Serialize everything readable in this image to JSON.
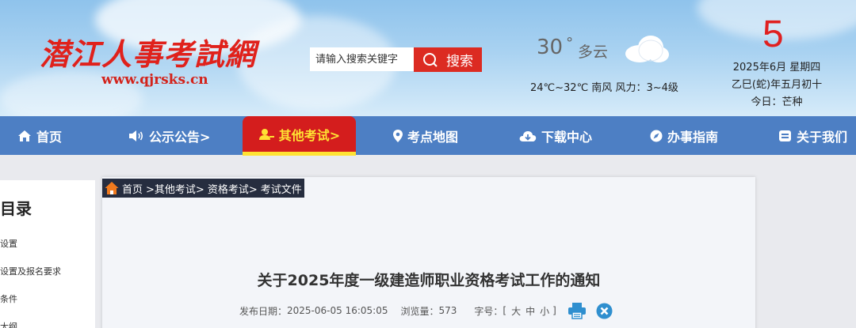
{
  "header": {
    "site_name": "潜江人事考試網",
    "site_url": "www.qjrsks.cn",
    "search": {
      "placeholder": "请输入搜索关键字",
      "button_label": "搜索"
    },
    "weather": {
      "temperature": "30",
      "degree": "°",
      "condition": "多云",
      "detail": "24℃~32℃ 南风 风力：3~4级"
    },
    "date": {
      "day": "5",
      "line1": "2025年6月  星期四",
      "line2": "乙巳(蛇)年五月初十",
      "line3": "今日：芒种"
    }
  },
  "nav": {
    "items": [
      {
        "label": "首页",
        "icon": "home-icon"
      },
      {
        "label": "公示公告>",
        "icon": "speaker-icon"
      },
      {
        "label": "其他考试>",
        "icon": "user-icon"
      },
      {
        "label": "考点地图",
        "icon": "location-icon"
      },
      {
        "label": "下载中心",
        "icon": "cloud-download-icon"
      },
      {
        "label": "办事指南",
        "icon": "compass-icon"
      },
      {
        "label": "关于我们",
        "icon": "info-icon"
      }
    ],
    "active_index": 2
  },
  "sidebar": {
    "title": "目录",
    "items": [
      "设置",
      "设置及报名要求",
      "条件",
      "大纲"
    ]
  },
  "breadcrumb": {
    "items": [
      "首页",
      " >其他考试>",
      "资格考试>",
      "考试文件"
    ]
  },
  "article": {
    "title": "关于2025年度一级建造师职业资格考试工作的通知",
    "publish_label": "发布日期：",
    "publish_date": "2025-06-05 16:05:05",
    "views_label": "浏览量：",
    "views": "573",
    "font_label": "字号：",
    "font_open": "[",
    "font_large": "大",
    "font_medium": "中",
    "font_small": "小",
    "font_close": "]"
  },
  "colors": {
    "nav_bg": "#4d7fc4",
    "nav_active_bg": "#d41d1d",
    "nav_active_text": "#ffe233",
    "accent_red": "#dc2b22",
    "breadcrumb_bg": "#262d3f"
  }
}
